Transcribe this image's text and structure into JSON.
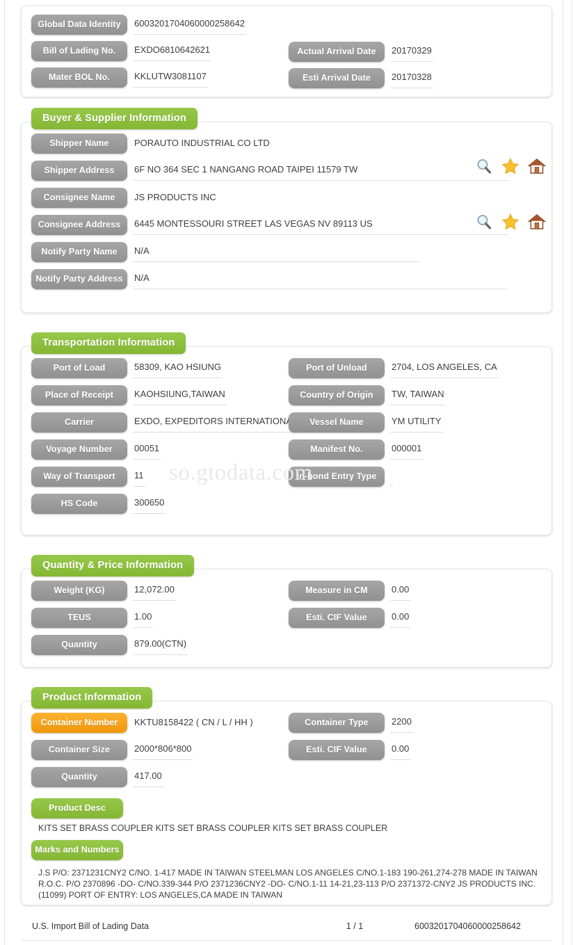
{
  "watermark": "so.gtodata.com",
  "header_card": {
    "fields": [
      {
        "label": "Global Data Identity",
        "value": "6003201704060000258642"
      },
      {
        "label": "Bill of Lading No.",
        "value": "EXDO6810642621"
      },
      {
        "label": "Mater BOL No.",
        "value": "KKLUTW3081107"
      }
    ],
    "right_fields": [
      {
        "label": "Actual Arrival Date",
        "value": "20170329"
      },
      {
        "label": "Esti Arrival Date",
        "value": "20170328"
      }
    ]
  },
  "buyer_supplier": {
    "title": "Buyer & Supplier Information",
    "fields": [
      {
        "label": "Shipper Name",
        "value": "PORAUTO INDUSTRIAL CO LTD"
      },
      {
        "label": "Shipper Address",
        "value": "6F NO 364 SEC 1 NANGANG ROAD TAIPEI 11579 TW"
      },
      {
        "label": "Consignee Name",
        "value": "JS PRODUCTS INC"
      },
      {
        "label": "Consignee Address",
        "value": "6445 MONTESSOURI STREET LAS VEGAS NV 89113 US"
      },
      {
        "label": "Notify Party Name",
        "value": "N/A"
      },
      {
        "label": "Notify Party Address",
        "value": "N/A"
      }
    ],
    "icons": [
      "search-icon",
      "star-icon",
      "home-icon"
    ]
  },
  "transportation": {
    "title": "Transportation Information",
    "left_fields": [
      {
        "label": "Port of Load",
        "value": "58309, KAO HSIUNG"
      },
      {
        "label": "Place of Receipt",
        "value": "KAOHSIUNG,TAIWAN"
      },
      {
        "label": "Carrier",
        "value": "EXDO, EXPEDITORS INTERNATIONAL"
      },
      {
        "label": "Voyage Number",
        "value": "00051"
      },
      {
        "label": "Way of Transport",
        "value": "11"
      },
      {
        "label": "HS Code",
        "value": "300650"
      }
    ],
    "right_fields": [
      {
        "label": "Port of Unload",
        "value": "2704, LOS ANGELES, CA"
      },
      {
        "label": "Country of Origin",
        "value": "TW, TAIWAN"
      },
      {
        "label": "Vessel Name",
        "value": "YM UTILITY"
      },
      {
        "label": "Manifest No.",
        "value": "000001"
      },
      {
        "label": "In-bond Entry Type",
        "value": ""
      }
    ]
  },
  "quantity_price": {
    "title": "Quantity & Price Information",
    "left_fields": [
      {
        "label": "Weight (KG)",
        "value": "12,072.00"
      },
      {
        "label": "TEUS",
        "value": "1.00"
      },
      {
        "label": "Quantity",
        "value": "879.00(CTN)"
      }
    ],
    "right_fields": [
      {
        "label": "Measure in CM",
        "value": "0.00"
      },
      {
        "label": "Esti. CIF Value",
        "value": "0.00"
      }
    ]
  },
  "product": {
    "title": "Product Information",
    "left_fields": [
      {
        "label": "Container Number",
        "value": "KKTU8158422 ( CN / L / HH )"
      },
      {
        "label": "Container Size",
        "value": "2000*806*800"
      },
      {
        "label": "Quantity",
        "value": "417.00"
      }
    ],
    "right_fields": [
      {
        "label": "Container Type",
        "value": "2200"
      },
      {
        "label": "Esti. CIF Value",
        "value": "0.00"
      }
    ],
    "product_desc_label": "Product Desc",
    "product_desc_value": "KITS SET BRASS COUPLER KITS SET BRASS COUPLER KITS SET BRASS COUPLER",
    "marks_label": "Marks and Numbers",
    "marks_value": "J.S P/O: 2371231CNY2 C/NO. 1-417 MADE IN TAIWAN STEELMAN LOS ANGELES C/NO.1-183 190-261,274-278 MADE IN TAIWAN R.O.C. P/O 2370896 -DO- C/NO.339-344 P/O 2371236CNY2 -DO- C/NO.1-11 14-21,23-113 P/O 2371372-CNY2 JS PRODUCTS INC. (11099) PORT OF ENTRY: LOS ANGELES,CA MADE IN TAIWAN"
  },
  "footer": {
    "left": "U.S. Import Bill of Lading Data",
    "page": "1 / 1",
    "right": "6003201704060000258642"
  },
  "colors": {
    "green": "#8fc13e",
    "gray": "#9b9b9b",
    "orange": "#f6a21c"
  }
}
